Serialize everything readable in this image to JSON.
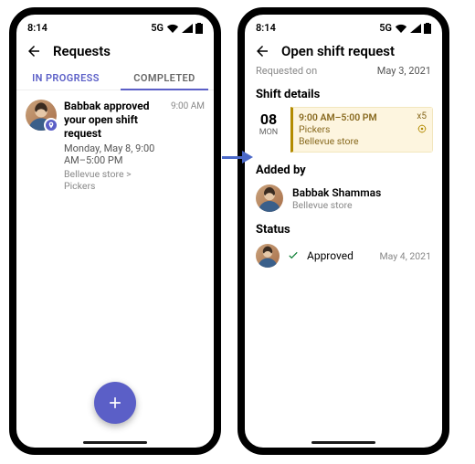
{
  "common": {
    "clock": "8:14",
    "network": "5G"
  },
  "left": {
    "title": "Requests",
    "tabs": {
      "in_progress": "IN PROGRESS",
      "completed": "COMPLETED"
    },
    "item": {
      "title": "Babbak approved your open shift request",
      "subtitle": "Monday, May 8, 9:00 AM–5:00 PM",
      "crumb": "Bellevue store > Pickers",
      "time": "9:00 AM"
    }
  },
  "right": {
    "title": "Open shift request",
    "requested_on_label": "Requested on",
    "requested_on_value": "May 3, 2021",
    "shift_details_label": "Shift details",
    "shift": {
      "day_num": "08",
      "dow": "MON",
      "time": "9:00 AM–5:00 PM",
      "group": "Pickers",
      "store": "Bellevue store",
      "count": "x5"
    },
    "added_by_label": "Added by",
    "added_by": {
      "name": "Babbak Shammas",
      "sub": "Bellevue store"
    },
    "status_label": "Status",
    "status": {
      "text": "Approved",
      "date": "May 4, 2021"
    }
  }
}
